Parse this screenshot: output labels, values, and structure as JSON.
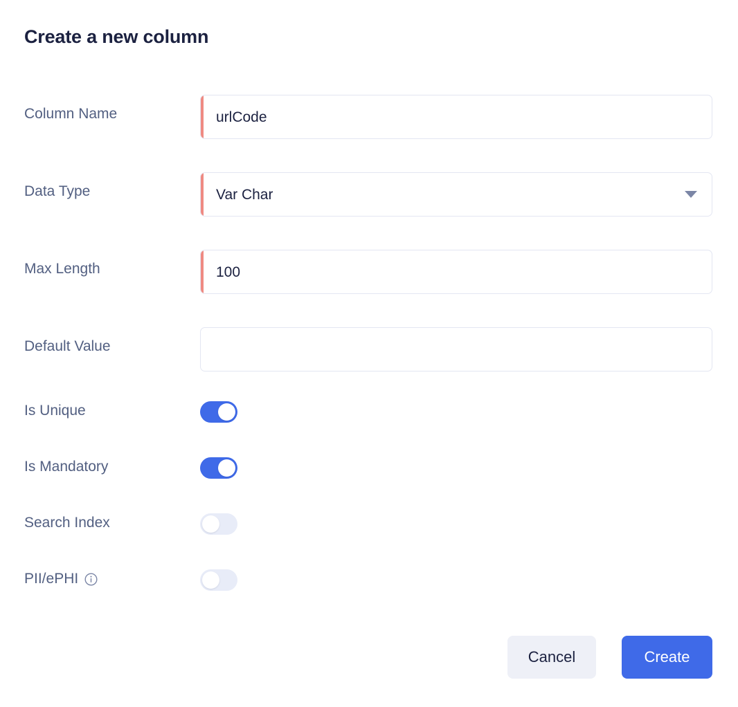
{
  "dialog": {
    "title": "Create a new column"
  },
  "fields": [
    {
      "label": "Column Name",
      "type": "text",
      "value": "urlCode",
      "placeholder": "",
      "required": true
    },
    {
      "label": "Data Type",
      "type": "select",
      "value": "Var Char",
      "placeholder": "",
      "required": true,
      "caret_icon": "chevron-down-icon"
    },
    {
      "label": "Max Length",
      "type": "text",
      "value": "100",
      "placeholder": "",
      "required": true
    },
    {
      "label": "Default Value",
      "type": "text",
      "value": "",
      "placeholder": "",
      "required": false
    }
  ],
  "toggles": [
    {
      "label": "Is Unique",
      "state": "on"
    },
    {
      "label": "Is Mandatory",
      "state": "on"
    },
    {
      "label": "Search Index",
      "state": "off"
    },
    {
      "label": "PII/ePHI",
      "state": "off",
      "info_icon": "info-icon"
    }
  ],
  "footer": {
    "cancel_label": "Cancel",
    "create_label": "Create"
  },
  "colors": {
    "accent_blue": "#3f6ae8",
    "required_bar": "#ef8a82",
    "label_text": "#525f81",
    "title_text": "#1b2140",
    "input_border": "#e3e6f2",
    "toggle_off": "#e8ecf8",
    "cancel_bg": "#eef0f7"
  }
}
